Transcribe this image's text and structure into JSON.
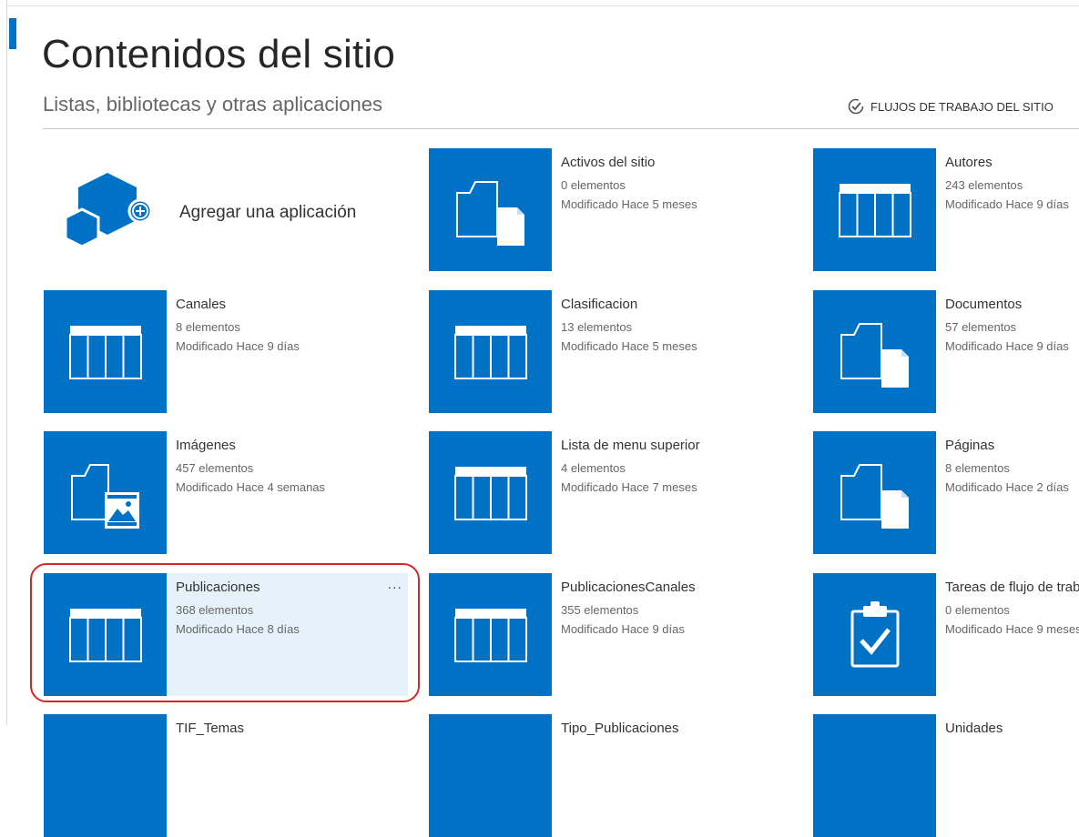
{
  "page": {
    "title": "Contenidos del sitio",
    "subtitle": "Listas, bibliotecas y otras aplicaciones",
    "workflows_link": "FLUJOS DE TRABAJO DEL SITIO"
  },
  "add_app": {
    "label": "Agregar una aplicación",
    "icon": "add-app-icon"
  },
  "accent_color": "#0072c6",
  "highlight_color": "#d92525",
  "tiles": [
    {
      "name": "Activos del sitio",
      "count": "0 elementos",
      "modified": "Modificado Hace 5 meses",
      "icon": "library-icon"
    },
    {
      "name": "Autores",
      "count": "243 elementos",
      "modified": "Modificado Hace 9 días",
      "icon": "list-icon"
    },
    {
      "name": "Canales",
      "count": "8 elementos",
      "modified": "Modificado Hace 9 días",
      "icon": "list-icon"
    },
    {
      "name": "Clasificacion",
      "count": "13 elementos",
      "modified": "Modificado Hace 5 meses",
      "icon": "list-icon"
    },
    {
      "name": "Documentos",
      "count": "57 elementos",
      "modified": "Modificado Hace 9 días",
      "icon": "library-icon"
    },
    {
      "name": "Imágenes",
      "count": "457 elementos",
      "modified": "Modificado Hace 4 semanas",
      "icon": "image-library-icon"
    },
    {
      "name": "Lista de menu superior",
      "count": "4 elementos",
      "modified": "Modificado Hace 7 meses",
      "icon": "list-icon"
    },
    {
      "name": "Páginas",
      "count": "8 elementos",
      "modified": "Modificado Hace 2 días",
      "icon": "library-icon"
    },
    {
      "name": "Publicaciones",
      "count": "368 elementos",
      "modified": "Modificado Hace 8 días",
      "icon": "list-icon",
      "selected": true,
      "more": "..."
    },
    {
      "name": "PublicacionesCanales",
      "count": "355 elementos",
      "modified": "Modificado Hace 9 días",
      "icon": "list-icon"
    },
    {
      "name": "Tareas de flujo de trabajo",
      "count": "0 elementos",
      "modified": "Modificado Hace 9 meses",
      "icon": "task-icon"
    },
    {
      "name": "TIF_Temas",
      "icon": "list-icon"
    },
    {
      "name": "Tipo_Publicaciones",
      "icon": "list-icon"
    },
    {
      "name": "Unidades",
      "icon": "list-icon"
    }
  ]
}
